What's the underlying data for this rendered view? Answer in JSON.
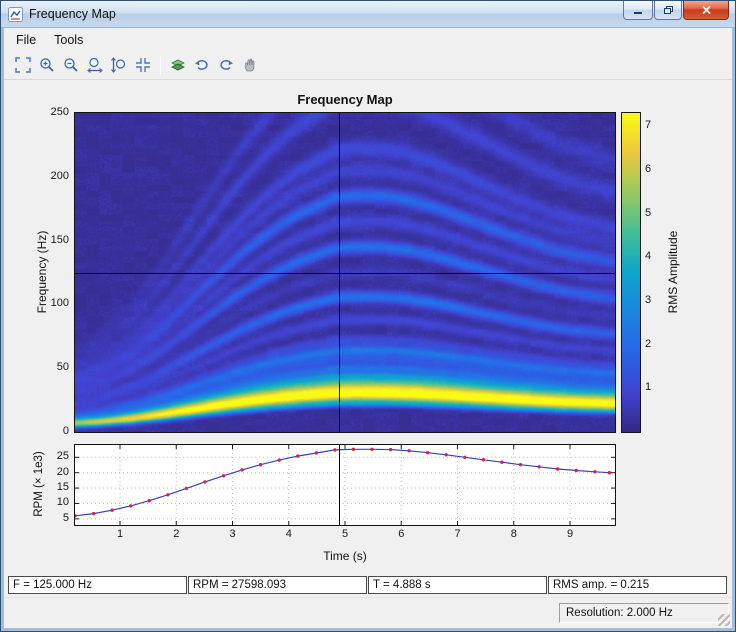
{
  "window": {
    "title": "Frequency Map"
  },
  "menu": {
    "items": [
      "File",
      "Tools"
    ]
  },
  "toolbar": {
    "icons": [
      "fit-view",
      "zoom-in",
      "zoom-out",
      "zoom-in-x",
      "zoom-in-y",
      "reset-view",
      "colormap",
      "undo-view",
      "redo-view",
      "pan"
    ]
  },
  "chart_data": [
    {
      "type": "heatmap",
      "title": "Frequency Map",
      "ylabel": "Frequency (Hz)",
      "ylim": [
        0,
        250
      ],
      "yticks": [
        0,
        50,
        100,
        150,
        200,
        250
      ],
      "xlim": [
        0.2,
        9.8
      ],
      "colorbar": {
        "label": "RMS Amplitude",
        "ticks": [
          1,
          2,
          3,
          4,
          5,
          6,
          7
        ],
        "range": [
          0,
          7.3
        ]
      },
      "crosshair": {
        "t": 4.888,
        "f": 125.0,
        "rms": 0.215,
        "rpm": 27598.093
      },
      "resolution_hz": 2.0,
      "rpm_ref": 27.6,
      "rpm_profile_t": [
        0.2,
        0.53,
        0.86,
        1.19,
        1.52,
        1.85,
        2.18,
        2.51,
        2.84,
        3.17,
        3.5,
        3.83,
        4.16,
        4.49,
        4.82,
        5.15,
        5.48,
        5.81,
        6.14,
        6.47,
        6.8,
        7.13,
        7.46,
        7.79,
        8.12,
        8.45,
        8.78,
        9.11,
        9.44,
        9.7
      ],
      "rpm_profile_krpm": [
        6.0,
        6.7,
        7.8,
        9.2,
        10.9,
        12.8,
        14.9,
        17.0,
        19.0,
        20.9,
        22.6,
        24.1,
        25.4,
        26.4,
        27.4,
        27.6,
        27.6,
        27.5,
        27.1,
        26.5,
        25.8,
        25.0,
        24.2,
        23.4,
        22.6,
        21.9,
        21.2,
        20.7,
        20.3,
        20.0
      ],
      "order_lines": [
        [
          22,
          2.6,
          1.8
        ],
        [
          26,
          3.8,
          2.0
        ],
        [
          30,
          6.8,
          2.2
        ],
        [
          34.5,
          5.2,
          2.2
        ],
        [
          39,
          3.6,
          2.4
        ],
        [
          44,
          2.6,
          2.4
        ],
        [
          50,
          1.7,
          2.6
        ],
        [
          57,
          1.2,
          2.8
        ],
        [
          64,
          2.0,
          2.8
        ],
        [
          72,
          0.9,
          3.0
        ],
        [
          88,
          0.8,
          3.2
        ],
        [
          106,
          1.9,
          3.4
        ],
        [
          125,
          0.4,
          3.5
        ],
        [
          145,
          1.8,
          3.6
        ],
        [
          165,
          0.8,
          3.8
        ],
        [
          185,
          1.7,
          4.0
        ],
        [
          205,
          0.7,
          4.2
        ],
        [
          222,
          0.9,
          4.5
        ],
        [
          260,
          0.8,
          5.0
        ],
        [
          295,
          0.6,
          5.5
        ]
      ]
    },
    {
      "type": "line",
      "xlabel": "Time (s)",
      "ylabel": "RPM (× 1e3)",
      "xlim": [
        0.2,
        9.8
      ],
      "ylim": [
        3,
        29
      ],
      "xticks": [
        1,
        2,
        3,
        4,
        5,
        6,
        7,
        8,
        9
      ],
      "yticks": [
        5,
        10,
        15,
        20,
        25
      ],
      "grid": true,
      "line_color": "#3344bb",
      "marker_color": "#d62244",
      "x": [
        0.2,
        0.53,
        0.86,
        1.19,
        1.52,
        1.85,
        2.18,
        2.51,
        2.84,
        3.17,
        3.5,
        3.83,
        4.16,
        4.49,
        4.82,
        5.15,
        5.48,
        5.81,
        6.14,
        6.47,
        6.8,
        7.13,
        7.46,
        7.79,
        8.12,
        8.45,
        8.78,
        9.11,
        9.44,
        9.7
      ],
      "y": [
        6.0,
        6.7,
        7.8,
        9.2,
        10.9,
        12.8,
        14.9,
        17.0,
        19.0,
        20.9,
        22.6,
        24.1,
        25.4,
        26.4,
        27.4,
        27.6,
        27.6,
        27.5,
        27.1,
        26.5,
        25.8,
        25.0,
        24.2,
        23.4,
        22.6,
        21.9,
        21.2,
        20.7,
        20.3,
        20.0
      ]
    }
  ],
  "readouts": [
    "F = 125.000 Hz",
    "RPM = 27598.093",
    "T = 4.888 s",
    "RMS amp. = 0.215"
  ],
  "statusbar": {
    "resolution": "Resolution: 2.000 Hz"
  }
}
